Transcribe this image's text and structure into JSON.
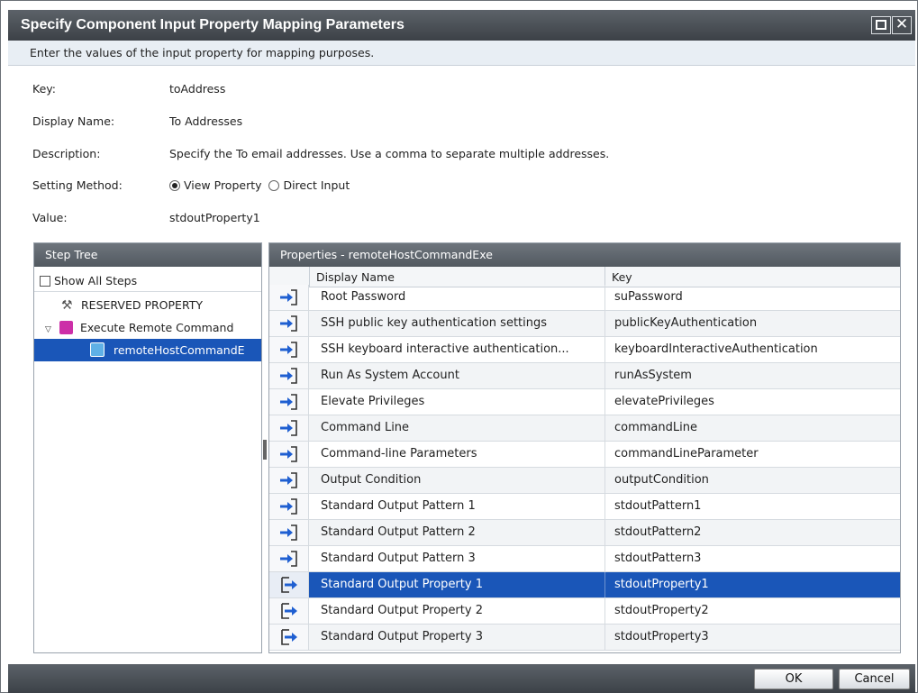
{
  "dialog": {
    "title": "Specify Component Input Property Mapping Parameters",
    "instruction": "Enter the values of the input property for mapping purposes.",
    "close_glyph": "✕"
  },
  "fields": {
    "key_label": "Key:",
    "key_value": "toAddress",
    "display_name_label": "Display Name:",
    "display_name_value": "To Addresses",
    "description_label": "Description:",
    "description_value": "Specify the To email addresses. Use a comma to separate multiple addresses.",
    "setting_method_label": "Setting Method:",
    "setting_method_options": [
      "View Property",
      "Direct Input"
    ],
    "setting_method_selected": "View Property",
    "value_label": "Value:",
    "value_value": "stdoutProperty1"
  },
  "step_tree": {
    "title": "Step Tree",
    "show_all_label": "Show All Steps",
    "items": [
      {
        "label": "RESERVED PROPERTY"
      },
      {
        "label": "Execute Remote Command"
      },
      {
        "label": "remoteHostCommandE"
      }
    ]
  },
  "properties": {
    "title": "Properties - remoteHostCommandExe",
    "columns": [
      "Display Name",
      "Key"
    ],
    "rows": [
      {
        "name": "Root Password",
        "key": "suPassword",
        "type": "input"
      },
      {
        "name": "SSH public key authentication settings",
        "key": "publicKeyAuthentication",
        "type": "input"
      },
      {
        "name": "SSH keyboard interactive authentication...",
        "key": "keyboardInteractiveAuthentication",
        "type": "input"
      },
      {
        "name": "Run As System Account",
        "key": "runAsSystem",
        "type": "input"
      },
      {
        "name": "Elevate Privileges",
        "key": "elevatePrivileges",
        "type": "input"
      },
      {
        "name": "Command Line",
        "key": "commandLine",
        "type": "input"
      },
      {
        "name": "Command-line Parameters",
        "key": "commandLineParameter",
        "type": "input"
      },
      {
        "name": "Output Condition",
        "key": "outputCondition",
        "type": "input"
      },
      {
        "name": "Standard Output Pattern 1",
        "key": "stdoutPattern1",
        "type": "input"
      },
      {
        "name": "Standard Output Pattern 2",
        "key": "stdoutPattern2",
        "type": "input"
      },
      {
        "name": "Standard Output Pattern 3",
        "key": "stdoutPattern3",
        "type": "input"
      },
      {
        "name": "Standard Output Property 1",
        "key": "stdoutProperty1",
        "type": "output",
        "selected": true
      },
      {
        "name": "Standard Output Property 2",
        "key": "stdoutProperty2",
        "type": "output"
      },
      {
        "name": "Standard Output Property 3",
        "key": "stdoutProperty3",
        "type": "output"
      }
    ]
  },
  "buttons": {
    "ok": "OK",
    "cancel": "Cancel"
  },
  "colors": {
    "selection": "#1a56b8",
    "titlebar": "#4a4f55",
    "input_arrow": "#1f5fd1"
  }
}
